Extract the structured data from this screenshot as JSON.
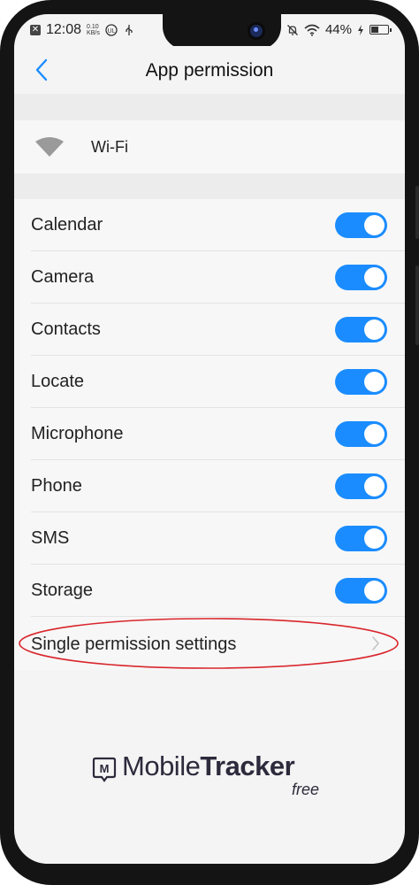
{
  "status_bar": {
    "time": "12:08",
    "speed_value": "0.10",
    "speed_unit": "KB/s",
    "battery_percent": "44%"
  },
  "header": {
    "title": "App permission",
    "back_icon": "chevron-left-icon"
  },
  "app": {
    "name": "Wi-Fi",
    "icon": "wifi-icon"
  },
  "permissions": [
    {
      "label": "Calendar",
      "enabled": true
    },
    {
      "label": "Camera",
      "enabled": true
    },
    {
      "label": "Contacts",
      "enabled": true
    },
    {
      "label": "Locate",
      "enabled": true
    },
    {
      "label": "Microphone",
      "enabled": true
    },
    {
      "label": "Phone",
      "enabled": true
    },
    {
      "label": "SMS",
      "enabled": true
    },
    {
      "label": "Storage",
      "enabled": true
    }
  ],
  "single_permission": {
    "label": "Single permission settings"
  },
  "watermark": {
    "brand_light": "Mobile",
    "brand_bold": "Tracker",
    "suffix": "free"
  },
  "colors": {
    "toggle_on": "#1a8cff",
    "accent_back": "#1a8cff",
    "highlight": "#d9262c"
  }
}
